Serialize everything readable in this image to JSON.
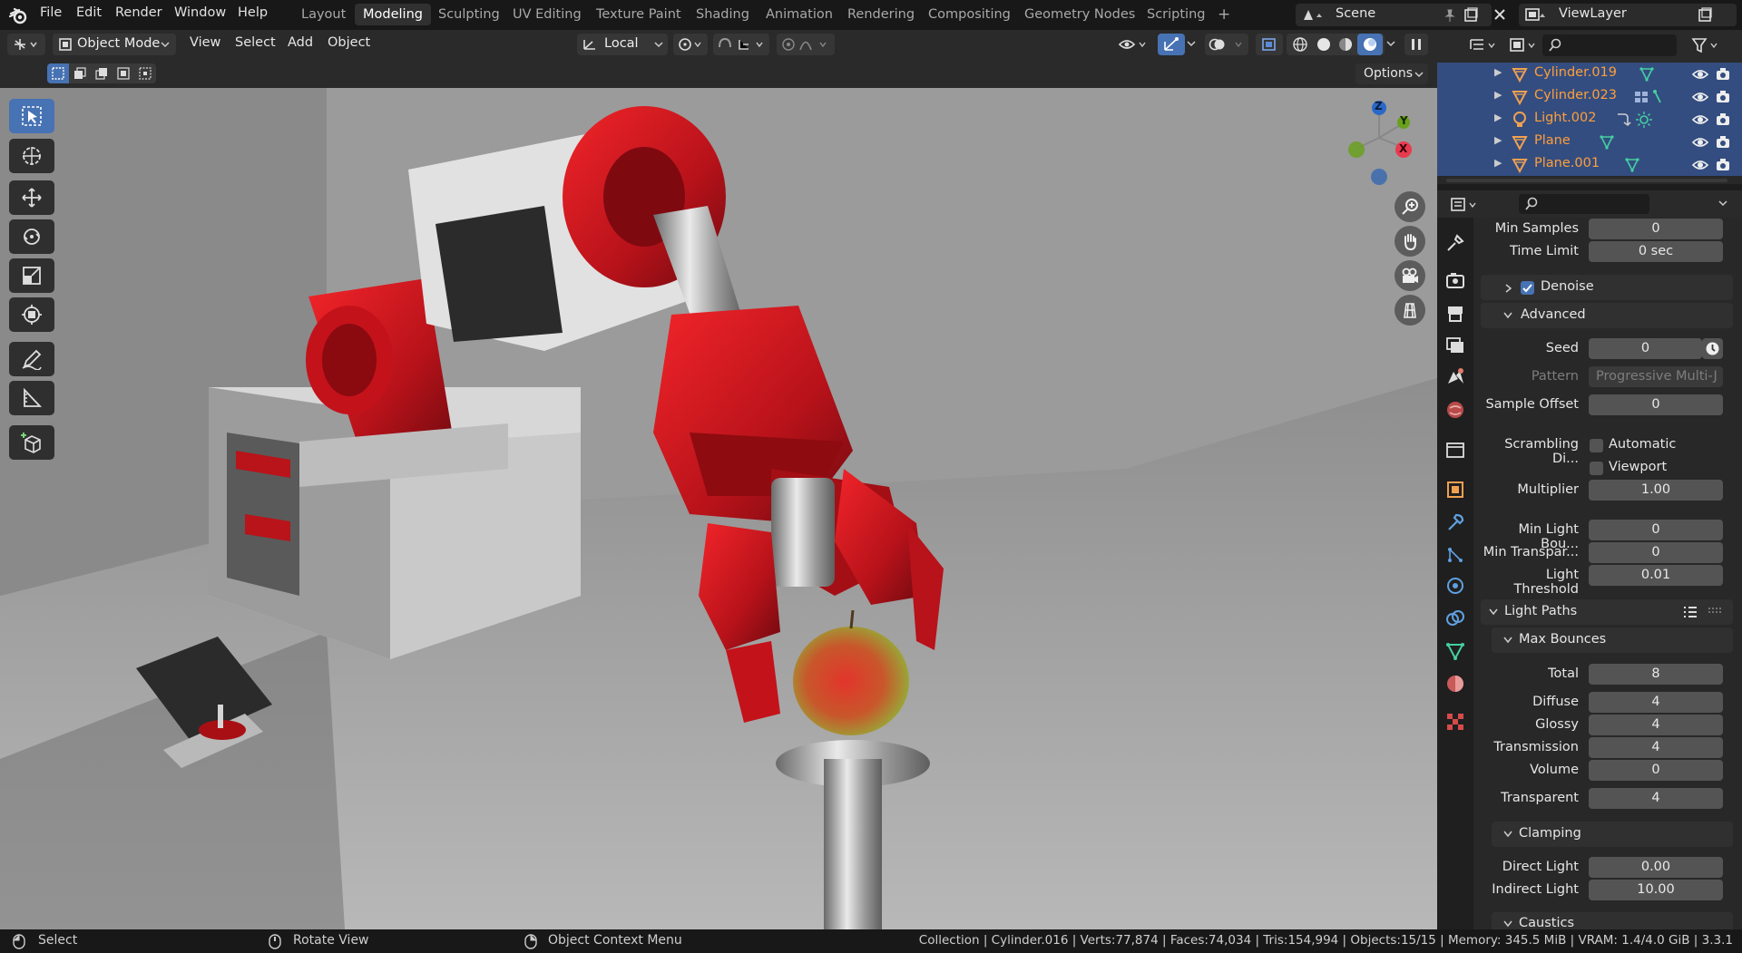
{
  "menubar": {
    "menus": [
      "File",
      "Edit",
      "Render",
      "Window",
      "Help"
    ],
    "workspaces": [
      "Layout",
      "Modeling",
      "Sculpting",
      "UV Editing",
      "Texture Paint",
      "Shading",
      "Animation",
      "Rendering",
      "Compositing",
      "Geometry Nodes",
      "Scripting"
    ],
    "active_workspace": "Modeling",
    "add_workspace": "+",
    "scene": "Scene",
    "view_layer": "ViewLayer"
  },
  "viewport_header": {
    "mode": "Object Mode",
    "menus": [
      "View",
      "Select",
      "Add",
      "Object"
    ],
    "transform_orientation": "Local",
    "options": "Options"
  },
  "gizmo": {
    "z": "Z",
    "y": "Y",
    "x": "X"
  },
  "outliner": {
    "items": [
      {
        "name": "Cylinder.019"
      },
      {
        "name": "Cylinder.023"
      },
      {
        "name": "Light.002"
      },
      {
        "name": "Plane"
      },
      {
        "name": "Plane.001"
      }
    ]
  },
  "properties": {
    "min_samples": {
      "label": "Min Samples",
      "value": "0"
    },
    "time_limit": {
      "label": "Time Limit",
      "value": "0 sec"
    },
    "denoise": {
      "label": "Denoise",
      "checked": true
    },
    "advanced": {
      "label": "Advanced"
    },
    "seed": {
      "label": "Seed",
      "value": "0"
    },
    "pattern": {
      "label": "Pattern",
      "value": "Progressive Multi-J"
    },
    "sample_offset": {
      "label": "Sample Offset",
      "value": "0"
    },
    "scrambling": {
      "label": "Scrambling Di...",
      "automatic": "Automatic",
      "viewport": "Viewport"
    },
    "multiplier": {
      "label": "Multiplier",
      "value": "1.00"
    },
    "min_light_bounces": {
      "label": "Min Light Bou...",
      "value": "0"
    },
    "min_transparent": {
      "label": "Min Transpar...",
      "value": "0"
    },
    "light_threshold": {
      "label": "Light Threshold",
      "value": "0.01"
    },
    "light_paths": {
      "label": "Light Paths"
    },
    "max_bounces": {
      "label": "Max Bounces"
    },
    "total": {
      "label": "Total",
      "value": "8"
    },
    "diffuse": {
      "label": "Diffuse",
      "value": "4"
    },
    "glossy": {
      "label": "Glossy",
      "value": "4"
    },
    "transmission": {
      "label": "Transmission",
      "value": "4"
    },
    "volume": {
      "label": "Volume",
      "value": "0"
    },
    "transparent": {
      "label": "Transparent",
      "value": "4"
    },
    "clamping": {
      "label": "Clamping"
    },
    "direct_light": {
      "label": "Direct Light",
      "value": "0.00"
    },
    "indirect_light": {
      "label": "Indirect Light",
      "value": "10.00"
    },
    "caustics": {
      "label": "Caustics"
    }
  },
  "statusbar": {
    "select": "Select",
    "rotate_view": "Rotate View",
    "context_menu": "Object Context Menu",
    "stats": "Collection | Cylinder.016 | Verts:77,874 | Faces:74,034 | Tris:154,994 | Objects:15/15 | Memory: 345.5 MiB | VRAM: 1.4/4.0 GiB | 3.3.1"
  },
  "colors": {
    "accent": "#4772b3",
    "outliner_selected": "#334d80",
    "object_name": "#ff9f3a",
    "robot_red": "#c8141a"
  }
}
